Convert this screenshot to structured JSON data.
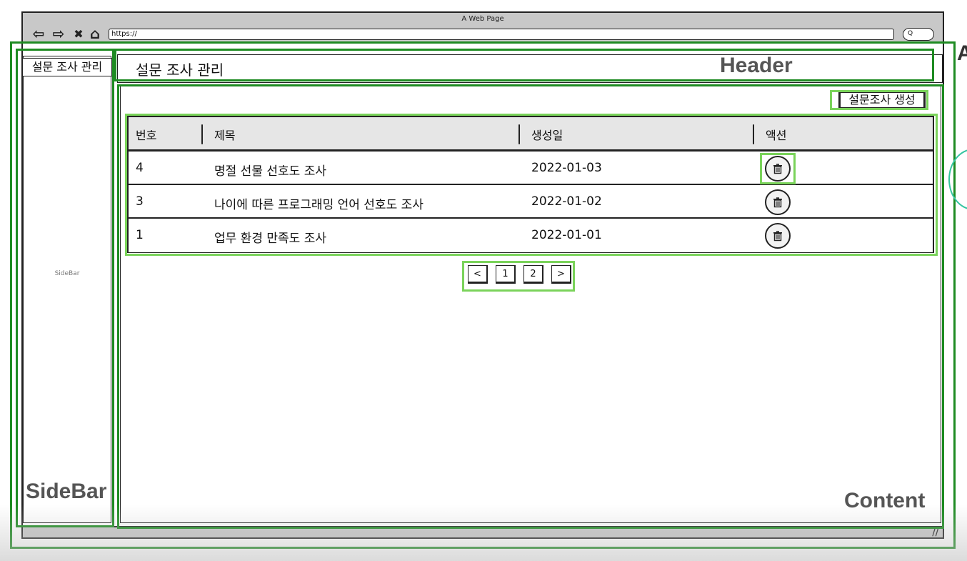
{
  "window": {
    "title": "A Web Page",
    "url": "https://",
    "search_glyph": "Q"
  },
  "nav": {
    "back_glyph": "⇦",
    "forward_glyph": "⇨",
    "close_glyph": "✖",
    "home_glyph": "⌂"
  },
  "sidebar": {
    "title": "설문 조사 관리",
    "caption": "SideBar",
    "label": "SideBar"
  },
  "header": {
    "title": "설문 조사 관리",
    "label": "Header"
  },
  "content": {
    "label": "Content",
    "create_button": "설문조사 생성"
  },
  "table": {
    "columns": [
      "번호",
      "제목",
      "생성일",
      "액션"
    ],
    "rows": [
      {
        "no": "4",
        "title": "명절 선물 선호도 조사",
        "date": "2022-01-03"
      },
      {
        "no": "3",
        "title": "나이에 따른 프로그래밍 언어 선호도 조사",
        "date": "2022-01-02"
      },
      {
        "no": "1",
        "title": "업무 환경 만족도 조사",
        "date": "2022-01-01"
      }
    ]
  },
  "pagination": {
    "prev": "<",
    "pages": [
      "1",
      "2"
    ],
    "next": ">"
  },
  "overlay": {
    "edge_letter": "A"
  },
  "colors": {
    "annotation_dark": "#1e8b22",
    "annotation_light": "#7ad35a",
    "chrome_gray": "#c8c8c8",
    "header_row": "#e6e6e6"
  }
}
